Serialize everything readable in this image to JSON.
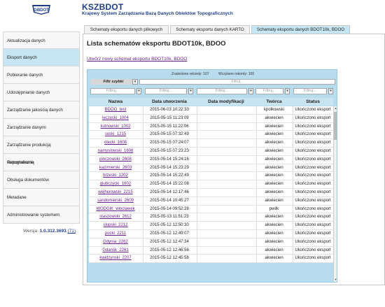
{
  "header": {
    "logo_text": "GBDOT",
    "title": "KSZBDOT",
    "subtitle": "Krajowy System Zarządzania Bazą Danych Obiektów Topograficznych"
  },
  "sidebar": {
    "items": [
      {
        "label": "Aktualizacja danych"
      },
      {
        "label": "Eksport danych"
      },
      {
        "label": "Pobieranie danych"
      },
      {
        "label": "Udostępnianie danych"
      },
      {
        "label": "Zarządzanie jakością danych"
      },
      {
        "label": "Zarządzanie danymi"
      },
      {
        "label": "Zarządzanie produkcją kartograficzną"
      },
      {
        "label": "Raportowanie"
      },
      {
        "label": "Obsługa dokumentów"
      },
      {
        "label": "Metadane"
      },
      {
        "label": "Administrowanie systemem"
      }
    ],
    "active_index": 1,
    "version_label": "Wersja:",
    "version": "1.0.312.3693",
    "version_count": "(71)"
  },
  "tabs": [
    {
      "label": "Schematy eksportu danych plikowych"
    },
    {
      "label": "Schematy eksportu danych KARTO"
    },
    {
      "label": "Schematy eksportu danych BDOT10k, BDOO"
    }
  ],
  "page": {
    "title": "Lista schematów eksportu BDOT10k, BDOO",
    "new_link": "Utwórz nowy schemat eksportu BDOT10k, BDOO"
  },
  "grid": {
    "found_label": "Znalezione rekordy: 107",
    "loaded_label": "Wczytane rekordy: 100",
    "quick_filter_label": "Filtr szybki",
    "filter_placeholder": "Filtruj...",
    "columns": [
      "Nazwa",
      "Data utworzenia",
      "Data modyfikacji",
      "Twórca",
      "Status"
    ],
    "rows": [
      [
        "BDOO_test",
        "2015-06-03 10:22:33",
        "",
        "kpolkowski",
        "Ukończono eksport"
      ],
      [
        "leczycki_1004",
        "2015-05-15 11:23:09",
        "",
        "akwiecien",
        "Ukończono eksport"
      ],
      [
        "kutnowski_1002",
        "2015-05-15 11:22:06",
        "",
        "akwiecien",
        "Ukończono eksport"
      ],
      [
        "suski_1215",
        "2015-05-15 07:32:49",
        "",
        "akwiecien",
        "Ukończono eksport"
      ],
      [
        "olecki_1608",
        "2015-05-15 07:24:07",
        "",
        "akwiecien",
        "Ukończono eksport"
      ],
      [
        "namyslowski_1606",
        "2015-05-15 07:23:23",
        "",
        "akwiecien",
        "Ukończono eksport"
      ],
      [
        "pinczowski_2608",
        "2015-05-14 15:24:16",
        "",
        "akwiecien",
        "Ukończono eksport"
      ],
      [
        "kazimierski_2603",
        "2015-05-14 15:23:29",
        "",
        "akwiecien",
        "Ukończono eksport"
      ],
      [
        "brzeski_1202",
        "2015-05-14 15:22:49",
        "",
        "akwiecien",
        "Ukończono eksport"
      ],
      [
        "glubczycki_1602",
        "2015-05-14 15:22:08",
        "",
        "akwiecien",
        "Ukończono eksport"
      ],
      [
        "wejherowski_2215",
        "2015-05-14 12:17:46",
        "",
        "akwiecien",
        "Ukończono eksport"
      ],
      [
        "sandomierski_2609",
        "2015-05-14 10:45:27",
        "",
        "akwiecien",
        "Ukończono eksport"
      ],
      [
        "WODGiK_wloclawek",
        "2015-05-14 09:52:28",
        "",
        "pwilk",
        "Ukończono eksport"
      ],
      [
        "staszowski_2612",
        "2015-05-13 11:51:23",
        "",
        "akwiecien",
        "Ukończono eksport"
      ],
      [
        "slupski_2212",
        "2015-05-12 12:50:30",
        "",
        "akwiecien",
        "Ukończono eksport"
      ],
      [
        "pucki_2211",
        "2015-05-12 12:49:07",
        "",
        "akwiecien",
        "Ukończono eksport"
      ],
      [
        "Gdynia_2262",
        "2015-05-12 12:47:34",
        "",
        "akwiecien",
        "Ukończono eksport"
      ],
      [
        "Gdansk_2261",
        "2015-05-12 12:46:56",
        "",
        "akwiecien",
        "Ukończono eksport"
      ],
      [
        "kwidzynski_2207",
        "2015-05-12 12:45:58",
        "",
        "akwiecien",
        "Ukończono eksport"
      ]
    ]
  }
}
